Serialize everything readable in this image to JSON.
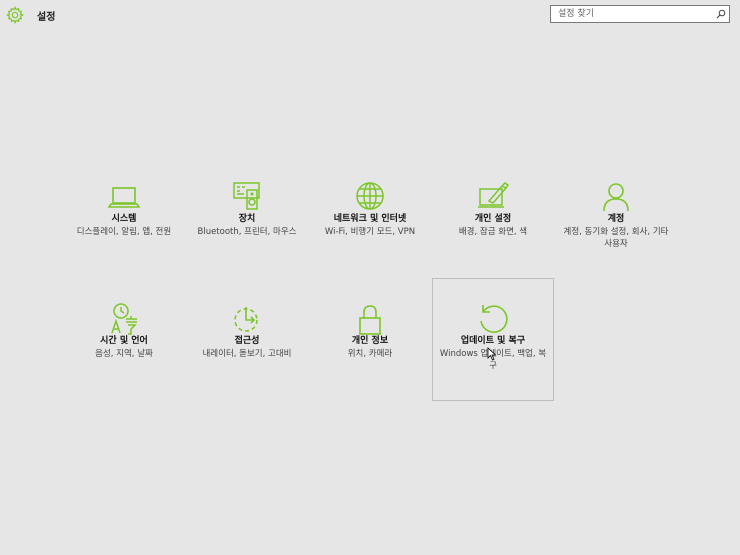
{
  "app": {
    "title": "설정",
    "icon": "gear-icon",
    "accent_color": "#7cc52a"
  },
  "search": {
    "placeholder": "설정 찾기",
    "icon": "search-icon"
  },
  "categories": [
    {
      "id": "system",
      "icon": "laptop-icon",
      "label": "시스템",
      "description": "디스플레이, 알림, 앱, 전원"
    },
    {
      "id": "devices",
      "icon": "devices-icon",
      "label": "장치",
      "description": "Bluetooth, 프린터, 마우스"
    },
    {
      "id": "network",
      "icon": "globe-icon",
      "label": "네트워크 및 인터넷",
      "description": "Wi-Fi, 비행기 모드, VPN"
    },
    {
      "id": "personalization",
      "icon": "personalization-icon",
      "label": "개인 설정",
      "description": "배경, 잠금 화면, 색"
    },
    {
      "id": "accounts",
      "icon": "person-icon",
      "label": "계정",
      "description": "계정, 동기화 설정, 회사, 기타 사용자"
    },
    {
      "id": "time-language",
      "icon": "time-language-icon",
      "label": "시간 및 언어",
      "description": "음성, 지역, 날짜"
    },
    {
      "id": "ease-of-access",
      "icon": "ease-of-access-icon",
      "label": "접근성",
      "description": "내레이터, 돋보기, 고대비"
    },
    {
      "id": "privacy",
      "icon": "lock-icon",
      "label": "개인 정보",
      "description": "위치, 카메라"
    },
    {
      "id": "update-recovery",
      "icon": "refresh-icon",
      "label": "업데이트 및 복구",
      "description": "Windows 업데이트, 백업, 복구",
      "selected": true
    }
  ]
}
